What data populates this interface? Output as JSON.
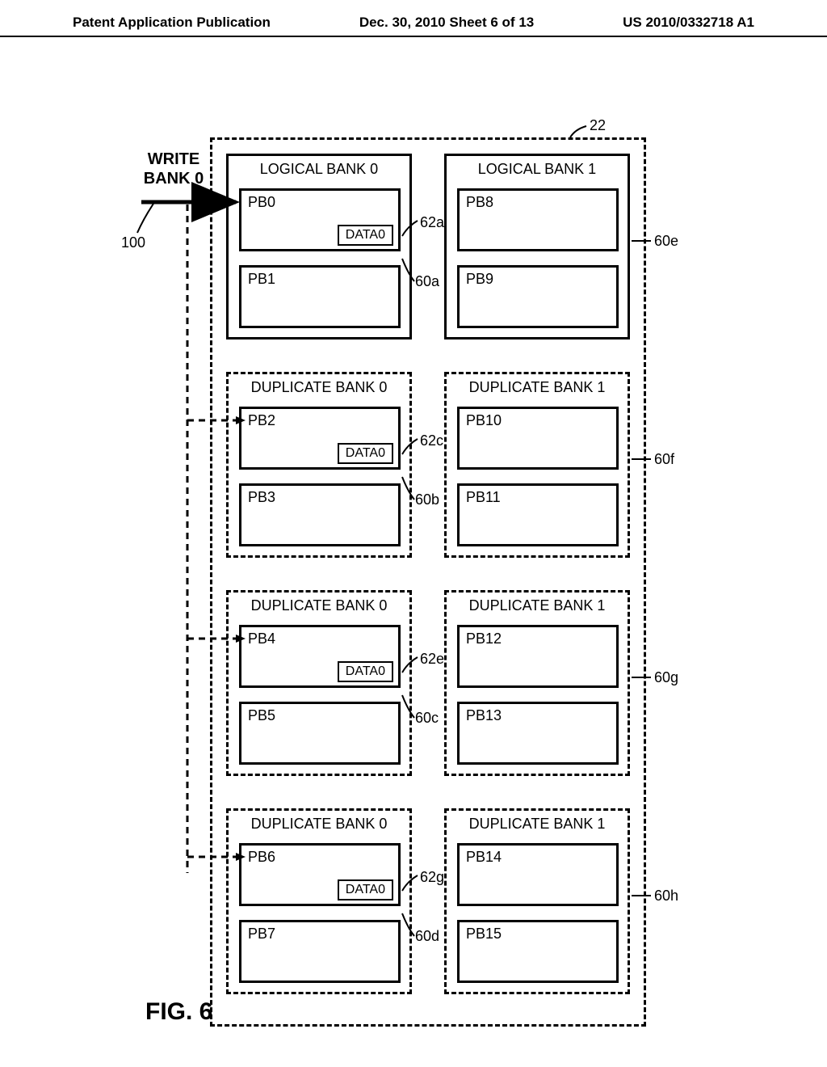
{
  "header": {
    "left": "Patent Application Publication",
    "center": "Dec. 30, 2010  Sheet 6 of 13",
    "right": "US 2010/0332718 A1"
  },
  "labels": {
    "write": "WRITE\nBANK 0",
    "fig": "FIG. 6"
  },
  "banks": {
    "logical0": "LOGICAL BANK 0",
    "logical1": "LOGICAL BANK 1",
    "dup0": "DUPLICATE BANK 0",
    "dup1": "DUPLICATE BANK 1"
  },
  "pb": {
    "pb0": "PB0",
    "pb1": "PB1",
    "pb2": "PB2",
    "pb3": "PB3",
    "pb4": "PB4",
    "pb5": "PB5",
    "pb6": "PB6",
    "pb7": "PB7",
    "pb8": "PB8",
    "pb9": "PB9",
    "pb10": "PB10",
    "pb11": "PB11",
    "pb12": "PB12",
    "pb13": "PB13",
    "pb14": "PB14",
    "pb15": "PB15"
  },
  "data": {
    "d0": "DATA0"
  },
  "refs": {
    "r22": "22",
    "r100": "100",
    "r60a": "60a",
    "r60b": "60b",
    "r60c": "60c",
    "r60d": "60d",
    "r60e": "60e",
    "r60f": "60f",
    "r60g": "60g",
    "r60h": "60h",
    "r62a": "62a",
    "r62c": "62c",
    "r62e": "62e",
    "r62g": "62g"
  }
}
